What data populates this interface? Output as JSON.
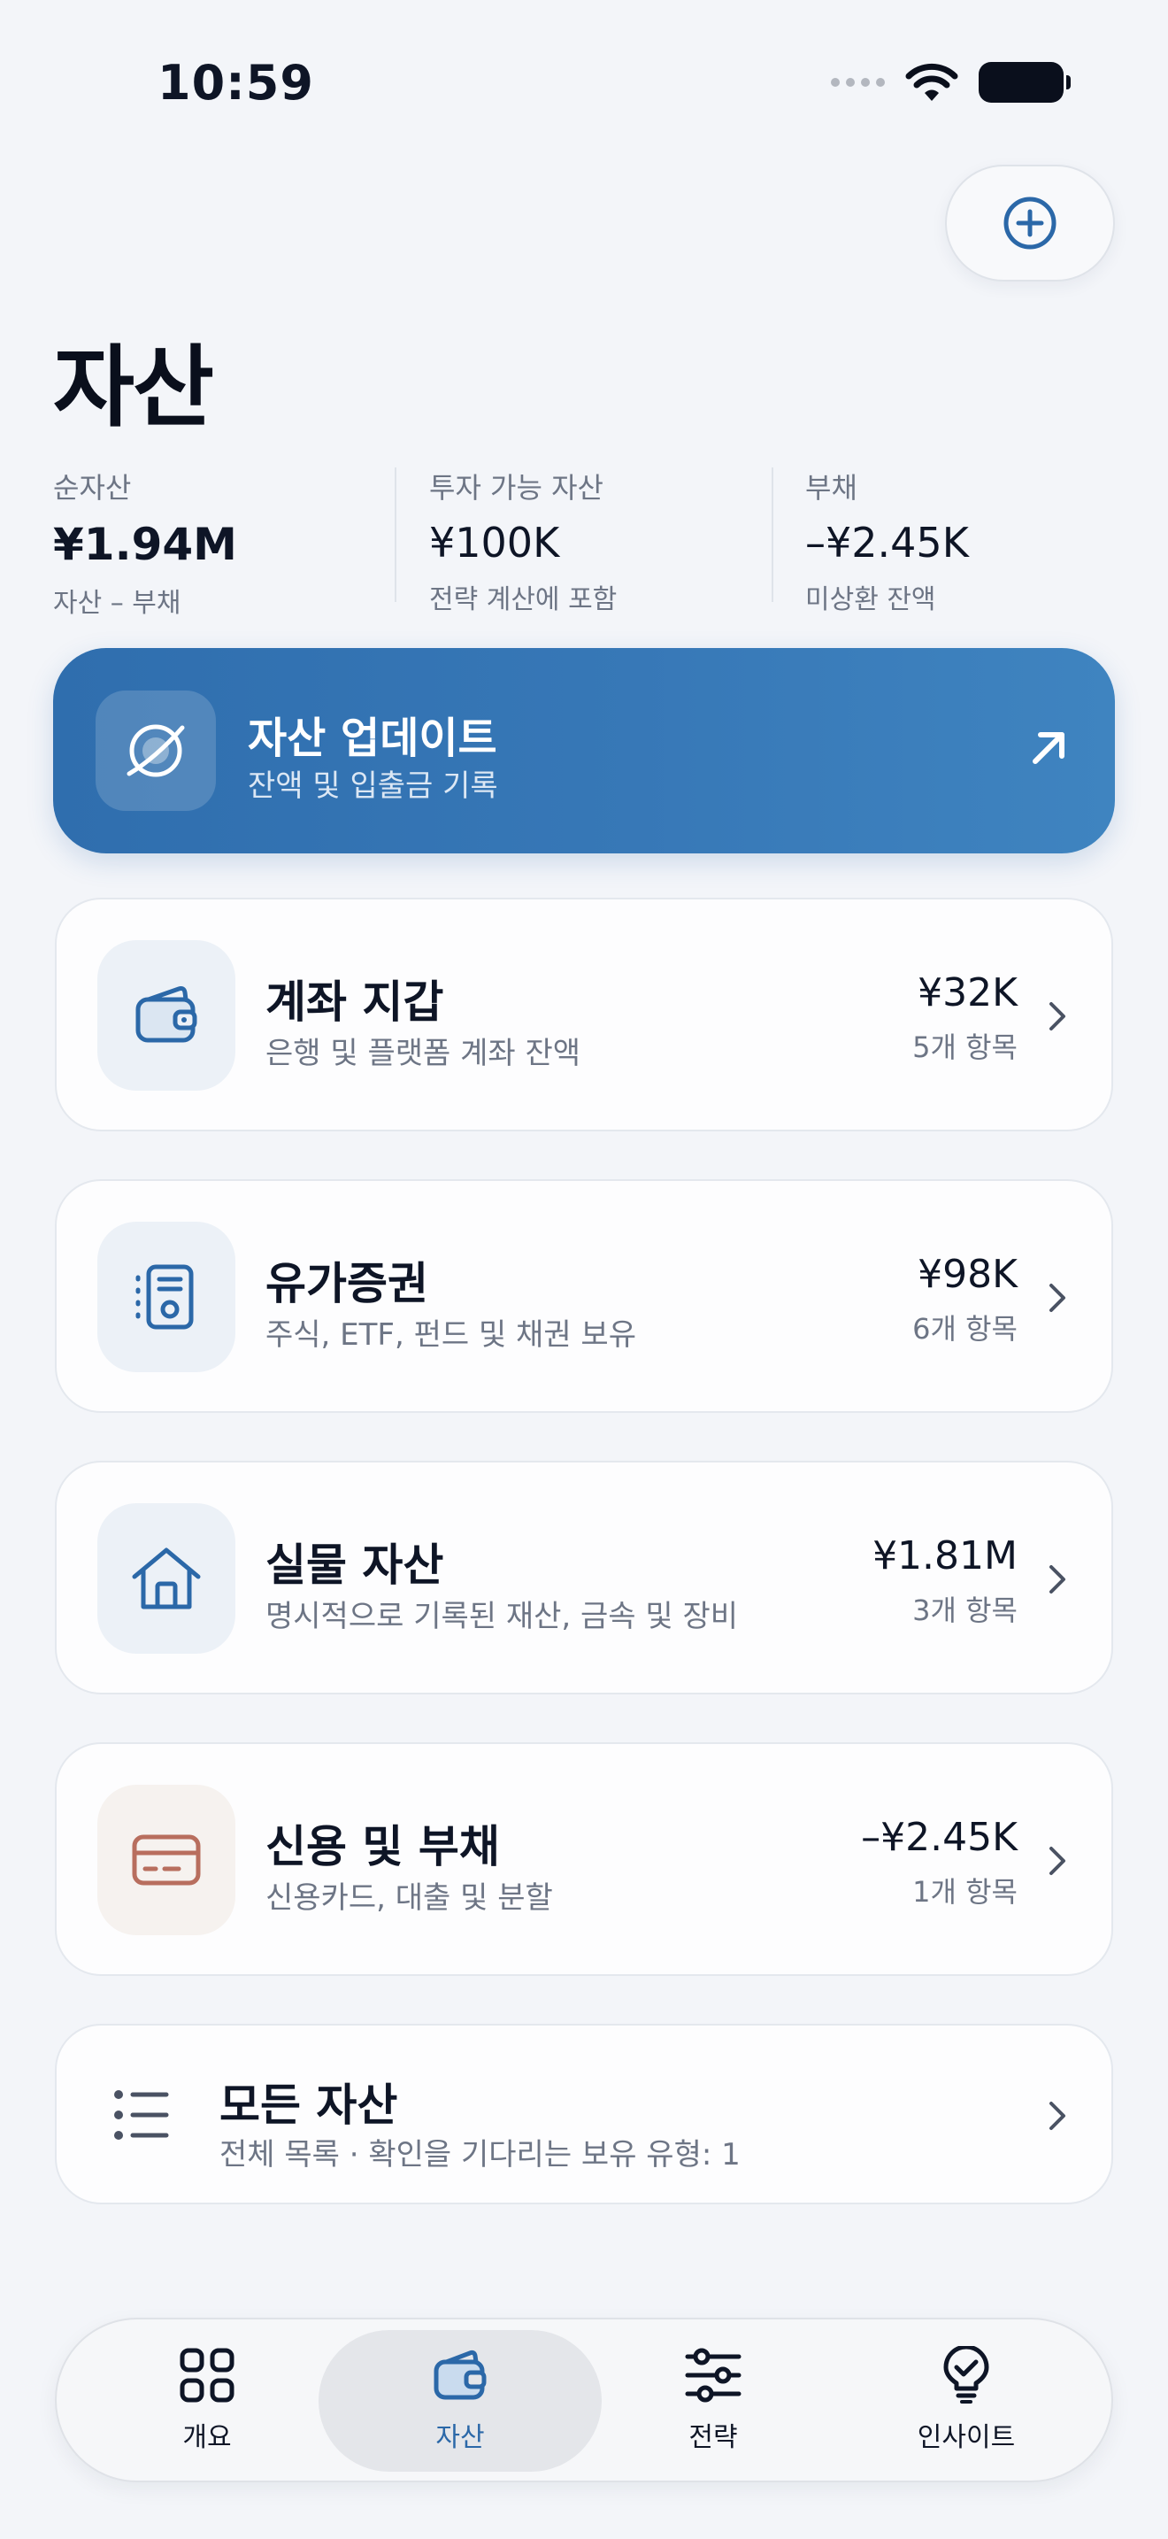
{
  "status_bar": {
    "time": "10:59"
  },
  "header": {
    "title": "자산"
  },
  "stats": [
    {
      "label": "순자산",
      "value": "¥1.94M",
      "sub": "자산 – 부채"
    },
    {
      "label": "투자 가능 자산",
      "value": "¥100K",
      "sub": "전략 계산에 포함"
    },
    {
      "label": "부채",
      "value": "–¥2.45K",
      "sub": "미상환 잔액"
    }
  ],
  "hero": {
    "title": "자산 업데이트",
    "subtitle": "잔액 및 입출금 기록"
  },
  "cards": [
    {
      "title": "계좌 지갑",
      "subtitle": "은행 및 플랫폼 계좌 잔액",
      "value": "¥32K",
      "count": "5개 항목",
      "icon": "wallet-icon"
    },
    {
      "title": "유가증권",
      "subtitle": "주식, ETF, 펀드 및 채권 보유",
      "value": "¥98K",
      "count": "6개 항목",
      "icon": "certificate-icon"
    },
    {
      "title": "실물 자산",
      "subtitle": "명시적으로 기록된 재산, 금속 및 장비",
      "value": "¥1.81M",
      "count": "3개 항목",
      "icon": "house-icon"
    },
    {
      "title": "신용 및 부채",
      "subtitle": "신용카드, 대출 및 분할",
      "value": "–¥2.45K",
      "count": "1개 항목",
      "icon": "credit-card-icon"
    }
  ],
  "all_assets": {
    "title": "모든 자산",
    "subtitle": "전체 목록 · 확인을 기다리는 보유 유형: 1"
  },
  "tabs": [
    {
      "label": "개요",
      "icon": "grid-icon",
      "active": false
    },
    {
      "label": "자산",
      "icon": "wallet-icon",
      "active": true
    },
    {
      "label": "전략",
      "icon": "sliders-icon",
      "active": false
    },
    {
      "label": "인사이트",
      "icon": "lightbulb-icon",
      "active": false
    }
  ],
  "colors": {
    "accent": "#2b68a8",
    "hero_start": "#2f6eae",
    "hero_end": "#3f84c0",
    "debt_icon": "#b86e5e"
  }
}
